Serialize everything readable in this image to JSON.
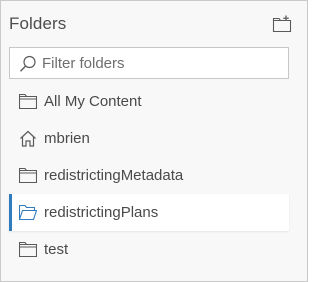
{
  "panel": {
    "title": "Folders",
    "new_folder_icon": "folder-plus-icon"
  },
  "search": {
    "placeholder": "Filter folders",
    "value": "",
    "icon": "search-icon"
  },
  "folders": [
    {
      "label": "All My Content",
      "icon": "folder-icon",
      "selected": false
    },
    {
      "label": "mbrien",
      "icon": "home-icon",
      "selected": false
    },
    {
      "label": "redistrictingMetadata",
      "icon": "folder-icon",
      "selected": false
    },
    {
      "label": "redistrictingPlans",
      "icon": "folder-open-icon",
      "selected": true
    },
    {
      "label": "test",
      "icon": "folder-icon",
      "selected": false
    }
  ],
  "colors": {
    "accent": "#2f7bbd",
    "text": "#4a4a4a",
    "panel_bg": "#f8f8f8",
    "border": "#c9c9c9"
  }
}
